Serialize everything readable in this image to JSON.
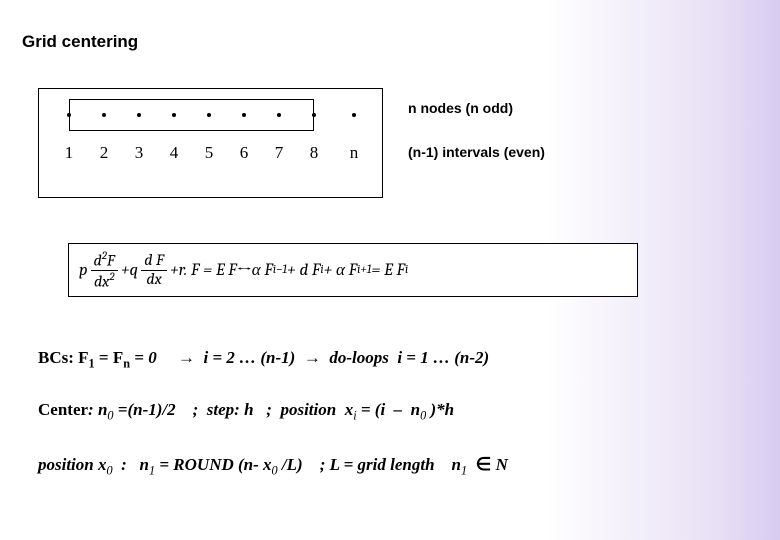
{
  "title": "Grid centering",
  "side1": "n nodes (n odd)",
  "side2": "(n-1) intervals (even)",
  "nodes": [
    "1",
    "2",
    "3",
    "4",
    "5",
    "6",
    "7",
    "8",
    "n"
  ],
  "eq": {
    "p": "p",
    "f1num_a": "d",
    "f1num_b": "2",
    "f1num_c": "F",
    "f1den_a": "dx",
    "f1den_b": "2",
    "plus1": " + ",
    "q": "q",
    "f2num": "d F",
    "f2den": "dx",
    "plus2": " + ",
    "rF": "r. F = E F",
    "arrow": "   ↔   ",
    "rhs_a": "α F",
    "rhs_a_sub": "i−1",
    "rhs_b": " + d F",
    "rhs_b_sub": "i",
    "rhs_c": " + α F",
    "rhs_c_sub": "i+1",
    "rhs_d": " = E F",
    "rhs_d_sub": "i"
  },
  "line1": {
    "a": "BCs: F",
    "a_sub": "1",
    "b": " = F",
    "b_sub": "n",
    "c": " = 0     →  i = 2 … (n-1)  →  do-loops  i = 1 … (n-2)"
  },
  "line2": {
    "a": "Center",
    "b": ": n",
    "b_sub": "0",
    "c": " =(n-1)/2    ;  step: h   ;  position  x",
    "c_sub": "i",
    "d": " = (i  –  n",
    "d_sub": "0",
    "e": " )*h"
  },
  "line3": {
    "a": "position  x",
    "a_sub": "0",
    "b": "  :   n",
    "b_sub": "1",
    "c": " = ROUND (n- x",
    "c_sub": "0",
    "d": " /L)    ; L = grid length    n",
    "d_sub": "1",
    "e": "  ",
    "f": "∈",
    "g": " N"
  }
}
